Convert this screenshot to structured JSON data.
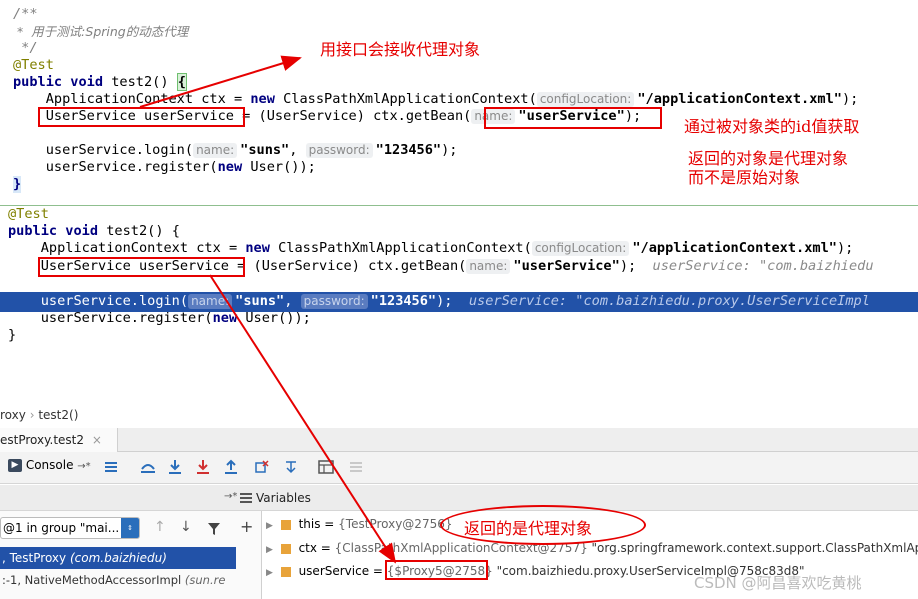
{
  "editor_top": {
    "comment_open": "/**",
    "comment_text": " *  用于测试:Spring的动态代理",
    "comment_close": " */",
    "annotation": "@Test",
    "sig_kw": "public void",
    "sig_rest": " test2() ",
    "sig_brace": "{",
    "line1_a": "    ApplicationContext ctx = ",
    "line1_new": "new",
    "line1_b": " ClassPathXmlApplicationContext(",
    "line1_hint": "configLocation:",
    "line1_str": "\"/applicationContext.xml\"",
    "line1_end": ");",
    "line2_a": "    UserService userService",
    "line2_b": " = (UserService) ctx.getBean(",
    "line2_hint": "name:",
    "line2_str": "\"userService\"",
    "line2_end": ");",
    "line3_a": "    userService.login(",
    "line3_hint1": "name:",
    "line3_str1": "\"suns\"",
    "line3_mid": ", ",
    "line3_hint2": "password:",
    "line3_str2": "\"123456\"",
    "line3_end": ");",
    "line4_a": "    userService.register(",
    "line4_new": "new",
    "line4_b": " User());",
    "close": "}"
  },
  "editor_bottom": {
    "annotation": "@Test",
    "sig_kw": "public void",
    "sig_rest": " test2() {",
    "line1_a": "    ApplicationContext ctx = ",
    "line1_new": "new",
    "line1_b": " ClassPathXmlApplicationContext(",
    "line1_hint": "configLocation:",
    "line1_str": "\"/applicationContext.xml\"",
    "line1_end": ");",
    "line2_a": "    UserService userService",
    "line2_b": " = (UserService) ctx.getBean(",
    "line2_hint": "name:",
    "line2_str": "\"userService\"",
    "line2_end": ");",
    "line2_inline": "  userService: \"com.baizhiedu",
    "line3_a": "    userService.login(",
    "line3_hint1": "name:",
    "line3_str1": "\"suns\"",
    "line3_mid": ", ",
    "line3_hint2": "password:",
    "line3_str2": "\"123456\"",
    "line3_end": ");",
    "line3_inline": "  userService: \"com.baizhiedu.proxy.UserServiceImpl",
    "line4_a": "    userService.register(",
    "line4_new": "new",
    "line4_b": " User());",
    "close": "}"
  },
  "annotations": {
    "note1": "用接口会接收代理对象",
    "note2": "通过被对象类的id值获取",
    "note3a": "返回的对象是代理对象",
    "note3b": "而不是原始对象",
    "note4": "返回的是代理对象"
  },
  "debug": {
    "breadcrumb_1": "roxy",
    "breadcrumb_sep": "›",
    "breadcrumb_2": "test2()",
    "tab_label": "estProxy.test2",
    "tab_close": "×",
    "console_label": "Console",
    "console_arrow": "→*",
    "vars_arrow": "→*",
    "vars_label": "Variables",
    "thread_select": "@1 in group \"mai...",
    "frames": [
      {
        "prefix": ", TestProxy ",
        "pkg": "(com.baizhiedu)"
      },
      {
        "prefix": ":-1, NativeMethodAccessorImpl ",
        "pkg": "(sun.re"
      }
    ],
    "vars": [
      {
        "name": "this",
        "eq": " = ",
        "val": "{TestProxy@2756}",
        "extra": ""
      },
      {
        "name": "ctx",
        "eq": " = ",
        "val": "{ClassPathXmlApplicationContext@2757}",
        "extra": " \"org.springframework.context.support.ClassPathXmlAp"
      },
      {
        "name": "userService",
        "eq": " = ",
        "val": "{$Proxy5@2758}",
        "extra": " \"com.baizhiedu.proxy.UserServiceImpl@758c83d8\""
      }
    ]
  },
  "watermark": "CSDN @阿昌喜欢吃黄桃",
  "colors": {
    "annotation_red": "#e60000",
    "selection": "#2252a8",
    "keyword": "#000080",
    "string": "#008000"
  }
}
